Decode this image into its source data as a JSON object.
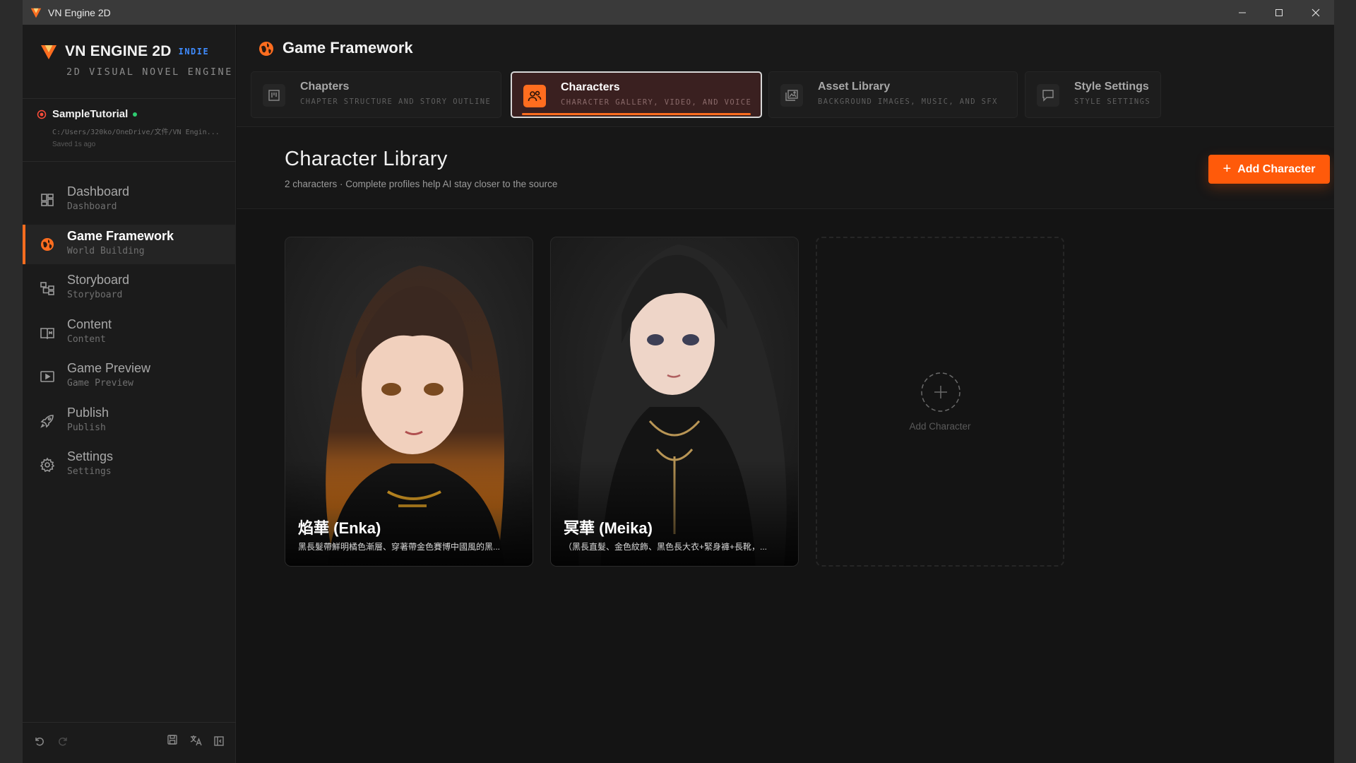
{
  "window": {
    "title": "VN Engine 2D"
  },
  "brand": {
    "name": "VN ENGINE 2D",
    "badge": "INDIE",
    "subtitle": "2D VISUAL NOVEL ENGINE",
    "accent": "#ff6d1f"
  },
  "project": {
    "name": "SampleTutorial",
    "path": "C:/Users/320ko/OneDrive/文件/VN Engin...",
    "saved": "Saved 1s ago"
  },
  "nav": {
    "items": [
      {
        "label": "Dashboard",
        "sub": "Dashboard",
        "icon": "dashboard-icon"
      },
      {
        "label": "Game Framework",
        "sub": "World Building",
        "icon": "globe-icon",
        "active": true
      },
      {
        "label": "Storyboard",
        "sub": "Storyboard",
        "icon": "storyboard-icon"
      },
      {
        "label": "Content",
        "sub": "Content",
        "icon": "book-icon"
      },
      {
        "label": "Game Preview",
        "sub": "Game Preview",
        "icon": "play-icon"
      },
      {
        "label": "Publish",
        "sub": "Publish",
        "icon": "rocket-icon"
      },
      {
        "label": "Settings",
        "sub": "Settings",
        "icon": "gear-icon"
      }
    ]
  },
  "header": {
    "title": "Game Framework"
  },
  "tabs": [
    {
      "label": "Chapters",
      "sub": "CHAPTER STRUCTURE AND STORY OUTLINE"
    },
    {
      "label": "Characters",
      "sub": "CHARACTER GALLERY, VIDEO, AND VOICE",
      "active": true
    },
    {
      "label": "Asset Library",
      "sub": "BACKGROUND IMAGES, MUSIC, AND SFX"
    },
    {
      "label": "Style Settings",
      "sub": "STYLE SETTINGS"
    }
  ],
  "library": {
    "title": "Character Library",
    "subtitle": "2 characters · Complete profiles help AI stay closer to the source",
    "add_label": "Add Character"
  },
  "characters": [
    {
      "name": "焰華 (Enka)",
      "desc": "黑長髮帶鮮明橘色漸層、穿著帶金色賽博中國風的黑..."
    },
    {
      "name": "冥華 (Meika)",
      "desc": "（黑長直髮、金色紋飾、黑色長大衣+緊身褲+長靴，..."
    }
  ],
  "add_card": {
    "label": "Add Character"
  }
}
